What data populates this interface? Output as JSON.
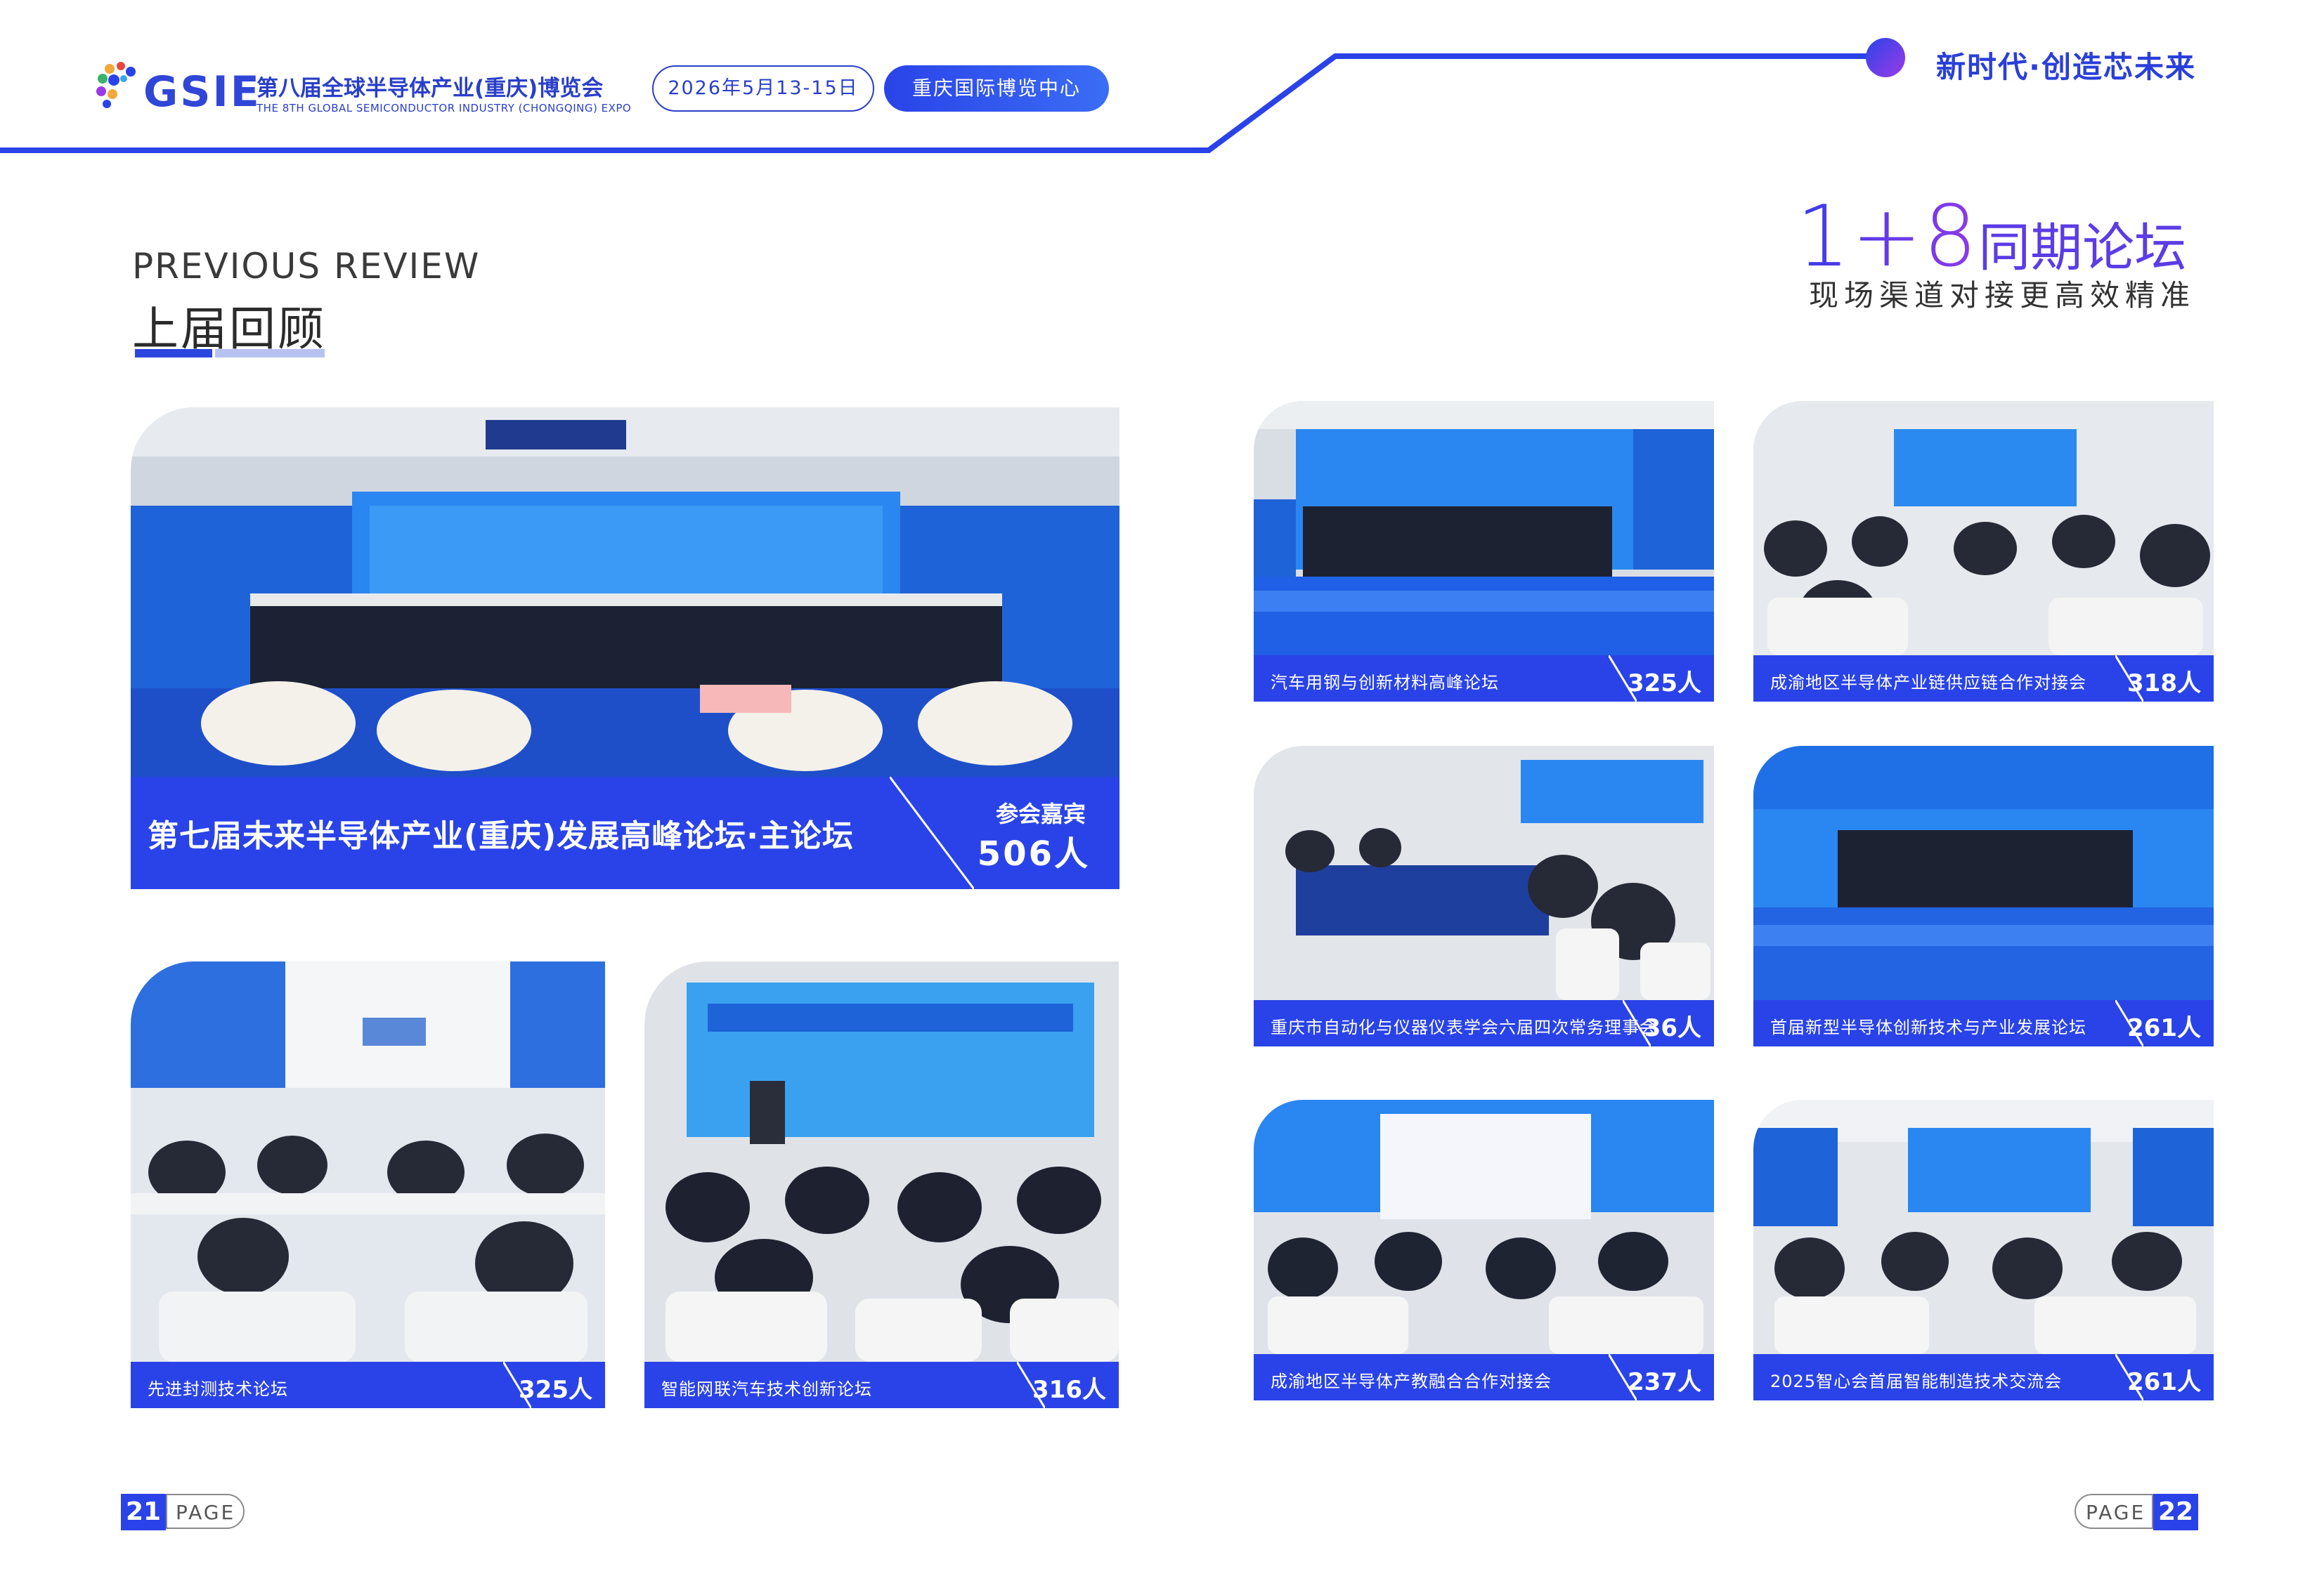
{
  "header": {
    "logo_text": "GSIE",
    "expo_name_cn": "第八届全球半导体产业(重庆)博览会",
    "expo_name_en": "THE 8TH GLOBAL SEMICONDUCTOR INDUSTRY (CHONGQING) EXPO",
    "date": "2026年5月13-15日",
    "venue": "重庆国际博览中心",
    "slogan": "新时代·创造芯未来"
  },
  "review": {
    "title_en": "PREVIOUS REVIEW",
    "title_cn": "上届回顾"
  },
  "forum_summary": {
    "number": "1+8",
    "label": "同期论坛",
    "subtitle": "现场渠道对接更高效精准"
  },
  "main_forum": {
    "name": "第七届未来半导体产业(重庆)发展高峰论坛·主论坛",
    "count_label": "参会嘉宾",
    "count": "506人"
  },
  "forums": [
    {
      "name": "先进封测技术论坛",
      "count": "325人"
    },
    {
      "name": "智能网联汽车技术创新论坛",
      "count": "316人"
    },
    {
      "name": "汽车用钢与创新材料高峰论坛",
      "count": "325人"
    },
    {
      "name": "成渝地区半导体产业链供应链合作对接会",
      "count": "318人"
    },
    {
      "name": "重庆市自动化与仪器仪表学会六届四次常务理事会",
      "count": "36人"
    },
    {
      "name": "首届新型半导体创新技术与产业发展论坛",
      "count": "261人"
    },
    {
      "name": "成渝地区半导体产教融合合作对接会",
      "count": "237人"
    },
    {
      "name": "2025智心会首届智能制造技术交流会",
      "count": "261人"
    }
  ],
  "pages": {
    "left_number": "21",
    "right_number": "22",
    "page_word": "PAGE"
  },
  "colors": {
    "brand_blue": "#2a43e8",
    "accent_purple": "#8e3be8"
  }
}
